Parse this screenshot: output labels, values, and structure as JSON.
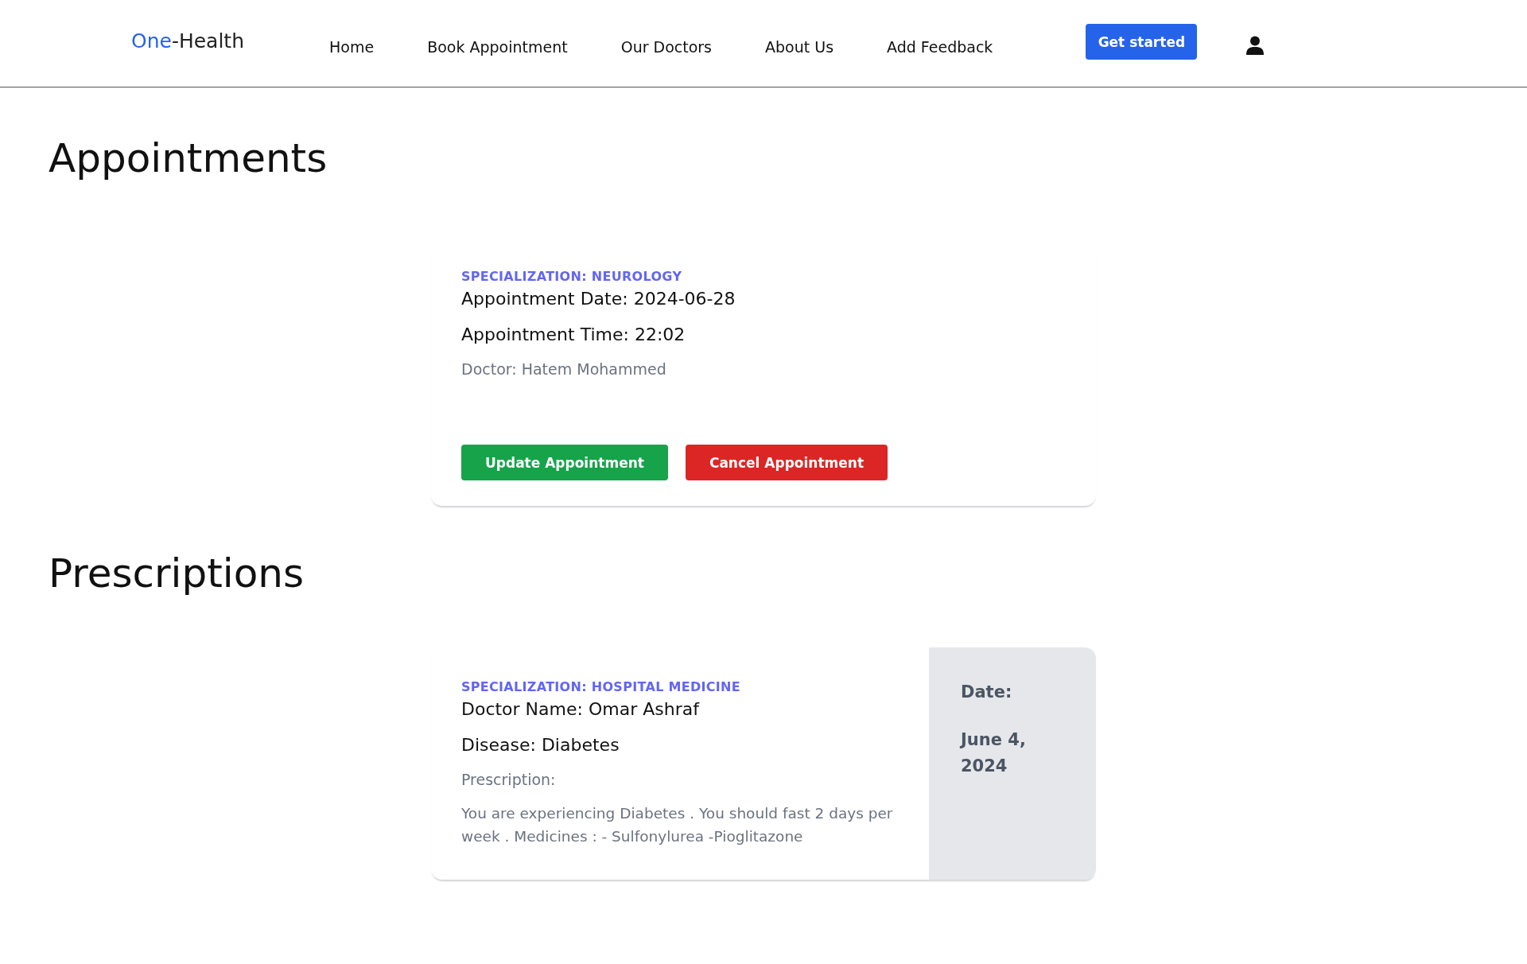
{
  "header": {
    "logo": {
      "brand_accent": "One",
      "brand_rest": "-Health"
    },
    "nav": [
      {
        "label": "Home"
      },
      {
        "label": "Book Appointment"
      },
      {
        "label": "Our Doctors"
      },
      {
        "label": "About Us"
      },
      {
        "label": "Add Feedback"
      }
    ],
    "cta": "Get started"
  },
  "appointments": {
    "title": "Appointments",
    "items": [
      {
        "specialization": "SPECIALIZATION: NEUROLOGY",
        "date": "Appointment Date: 2024-06-28",
        "time": "Appointment Time: 22:02",
        "doctor": "Doctor: Hatem Mohammed",
        "buttons": [
          {
            "kind": "update",
            "label": "Update Appointment"
          },
          {
            "kind": "cancel",
            "label": "Cancel Appointment"
          }
        ]
      }
    ]
  },
  "prescriptions": {
    "title": "Prescriptions",
    "items": [
      {
        "specialization": "SPECIALIZATION: HOSPITAL MEDICINE",
        "doctor": "Doctor Name: Omar Ashraf",
        "disease": "Disease: Diabetes",
        "label": "Prescription:",
        "text": "You are experiencing Diabetes . You should fast 2 days per week . Medicines : - Sulfonylurea -Pioglitazone",
        "date_label": "Date:",
        "date": "June 4, 2024"
      }
    ]
  }
}
